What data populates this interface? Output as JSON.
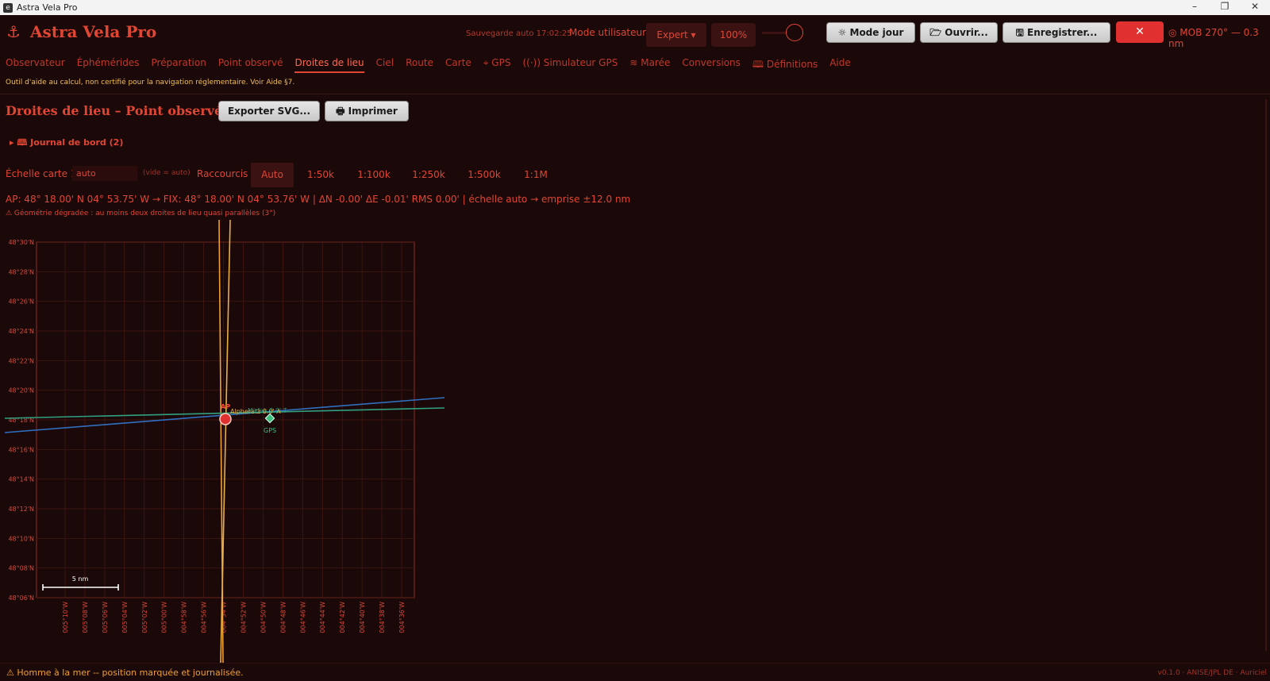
{
  "window": {
    "title": "Astra Vela Pro",
    "app_icon": "e",
    "minimize": "–",
    "maximize": "❐",
    "close": "✕"
  },
  "header": {
    "anchor_icon": "⚓",
    "app_name": "Astra Vela Pro",
    "autosave": "Sauvegarde auto 17:02:25",
    "mode_label": "Mode utilisateur :",
    "mode_value": "Expert ▾",
    "zoom": "100%",
    "day_mode": "☼ Mode jour",
    "open": "🗁 Ouvrir...",
    "save": "🖫 Enregistrer...",
    "mob_close": "✕",
    "mob": "◎ MOB 270° — 0.3 nm"
  },
  "nav": [
    {
      "label": "Observateur",
      "active": false
    },
    {
      "label": "Éphémérides",
      "active": false
    },
    {
      "label": "Préparation",
      "active": false
    },
    {
      "label": "Point observé",
      "active": false
    },
    {
      "label": "Droites de lieu",
      "active": true
    },
    {
      "label": "Ciel",
      "active": false
    },
    {
      "label": "Route",
      "active": false
    },
    {
      "label": "Carte",
      "active": false
    },
    {
      "label": "⌖ GPS",
      "active": false
    },
    {
      "label": "((·)) Simulateur GPS",
      "active": false
    },
    {
      "label": "≋ Marée",
      "active": false
    },
    {
      "label": "Conversions",
      "active": false
    },
    {
      "label": "🕮 Définitions",
      "active": false
    },
    {
      "label": "Aide",
      "active": false
    }
  ],
  "notice": "Outil d'aide au calcul, non certifié pour la navigation réglementaire. Voir Aide §7.",
  "section": {
    "title": "Droites de lieu – Point observé",
    "export_svg": "Exporter SVG...",
    "print": "🖶 Imprimer"
  },
  "journal": "▸ 🕮 Journal de bord (2)",
  "scale": {
    "label": "Échelle carte 1:",
    "value": "auto",
    "hint": "(vide = auto)",
    "shortcuts_label": "Raccourcis :",
    "shortcuts": [
      "Auto",
      "1:50k",
      "1:100k",
      "1:250k",
      "1:500k",
      "1:1M"
    ],
    "active": "Auto"
  },
  "position_line": "AP: 48° 18.00' N 04° 53.75' W   →   FIX: 48° 18.00' N 04° 53.76' W    |    ΔN -0.00'   ΔE -0.01'   RMS 0.00'    |    échelle auto  →  emprise ±12.0 nm",
  "warning": "⚠ Géométrie dégradée : au moins deux droites de lieu quasi parallèles (3°)",
  "chart_data": {
    "type": "scatter",
    "title": "",
    "xlabel": "",
    "ylabel": "",
    "xlim": [
      -5.2,
      -4.6
    ],
    "ylim": [
      48.1,
      48.5
    ],
    "y_ticks": [
      "48°30'N",
      "48°28'N",
      "48°26'N",
      "48°24'N",
      "48°22'N",
      "48°20'N",
      "48°18'N",
      "48°16'N",
      "48°14'N",
      "48°12'N",
      "48°10'N",
      "48°08'N",
      "48°06'N"
    ],
    "x_ticks": [
      "005°10'W",
      "005°08'W",
      "005°06'W",
      "005°04'W",
      "005°02'W",
      "005°00'W",
      "004°58'W",
      "004°56'W",
      "004°54'W",
      "004°52'W",
      "004°50'W",
      "004°48'W",
      "004°46'W",
      "004°44'W",
      "004°42'W",
      "004°40'W",
      "004°38'W",
      "004°36'W"
    ],
    "points": [
      {
        "label": "AP",
        "lat": "48° 18.00' N",
        "lon": "04° 53.75' W",
        "color": "#e03030"
      },
      {
        "label": "GPS",
        "lat": "48° 18.00' N",
        "lon": "004°50'W",
        "color": "#40c080"
      }
    ],
    "lines_of_position": [
      {
        "color": "#f0a030",
        "description": "quasi-vertical LOP"
      },
      {
        "color": "#e8b040",
        "description": "quasi-vertical LOP"
      },
      {
        "color": "#3070c0",
        "description": "shallow LOP"
      },
      {
        "color": "#30a080",
        "description": "shallow LOP"
      }
    ],
    "annotations": [
      "Alpheratz 0.0' A",
      "Mirfak 0.0' T"
    ],
    "scale_bar": "5 nm"
  },
  "status": "⚠ Homme à la mer -- position marquée et journalisée.",
  "version": "v0.1.0 · ANISE/JPL DE · Auriciel"
}
